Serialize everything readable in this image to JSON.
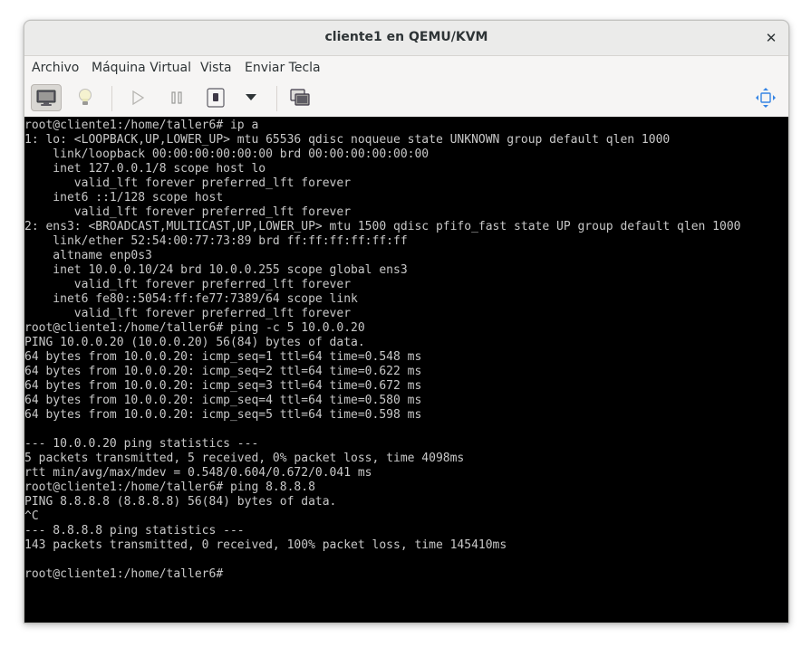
{
  "window": {
    "title": "cliente1 en QEMU/KVM",
    "close_label": "✕"
  },
  "menu": {
    "items": [
      "Archivo",
      "Máquina Virtual",
      "Vista",
      "Enviar Tecla"
    ]
  },
  "toolbar": {
    "console_icon": "monitor-icon",
    "details_icon": "lightbulb-icon",
    "run_icon": "play-icon",
    "pause_icon": "pause-icon",
    "shutdown_icon": "power-icon",
    "shutdown_menu_icon": "chevron-down-icon",
    "snapshots_icon": "snapshots-icon",
    "fullscreen_icon": "resize-arrows-icon"
  },
  "terminal": {
    "lines": [
      "root@cliente1:/home/taller6# ip a",
      "1: lo: <LOOPBACK,UP,LOWER_UP> mtu 65536 qdisc noqueue state UNKNOWN group default qlen 1000",
      "    link/loopback 00:00:00:00:00:00 brd 00:00:00:00:00:00",
      "    inet 127.0.0.1/8 scope host lo",
      "       valid_lft forever preferred_lft forever",
      "    inet6 ::1/128 scope host",
      "       valid_lft forever preferred_lft forever",
      "2: ens3: <BROADCAST,MULTICAST,UP,LOWER_UP> mtu 1500 qdisc pfifo_fast state UP group default qlen 1000",
      "    link/ether 52:54:00:77:73:89 brd ff:ff:ff:ff:ff:ff",
      "    altname enp0s3",
      "    inet 10.0.0.10/24 brd 10.0.0.255 scope global ens3",
      "       valid_lft forever preferred_lft forever",
      "    inet6 fe80::5054:ff:fe77:7389/64 scope link",
      "       valid_lft forever preferred_lft forever",
      "root@cliente1:/home/taller6# ping -c 5 10.0.0.20",
      "PING 10.0.0.20 (10.0.0.20) 56(84) bytes of data.",
      "64 bytes from 10.0.0.20: icmp_seq=1 ttl=64 time=0.548 ms",
      "64 bytes from 10.0.0.20: icmp_seq=2 ttl=64 time=0.622 ms",
      "64 bytes from 10.0.0.20: icmp_seq=3 ttl=64 time=0.672 ms",
      "64 bytes from 10.0.0.20: icmp_seq=4 ttl=64 time=0.580 ms",
      "64 bytes from 10.0.0.20: icmp_seq=5 ttl=64 time=0.598 ms",
      "",
      "--- 10.0.0.20 ping statistics ---",
      "5 packets transmitted, 5 received, 0% packet loss, time 4098ms",
      "rtt min/avg/max/mdev = 0.548/0.604/0.672/0.041 ms",
      "root@cliente1:/home/taller6# ping 8.8.8.8",
      "PING 8.8.8.8 (8.8.8.8) 56(84) bytes of data.",
      "^C",
      "--- 8.8.8.8 ping statistics ---",
      "143 packets transmitted, 0 received, 100% packet loss, time 145410ms",
      "",
      "root@cliente1:/home/taller6# "
    ]
  },
  "colors": {
    "terminal_bg": "#000000",
    "terminal_fg": "#c8c8c8",
    "fullscreen_icon": "#3584e4"
  }
}
